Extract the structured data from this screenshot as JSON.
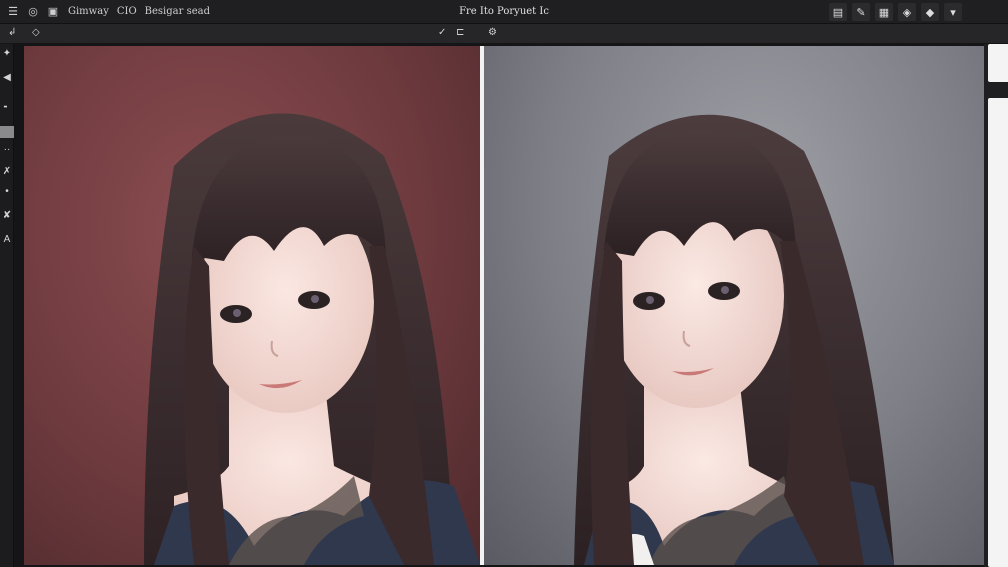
{
  "topbar": {
    "menus": [
      "Gimway",
      "CIO",
      "Besigar sead"
    ],
    "title": "Fre Ito Poryuet Ic"
  },
  "portrait_icon": "portrait-figure-icon",
  "icons": {
    "menu": "hamburger-icon",
    "app": "app-logo-icon",
    "square": "square-icon",
    "tool_move": "move-icon",
    "tool_lasso": "lasso-icon",
    "tool_brush": "brush-icon",
    "tool_rect": "rectangle-icon",
    "tool_heal": "heal-icon",
    "tool_text": "text-icon"
  },
  "colors": {
    "left_background": "#6e3a3e",
    "right_background": "#7d7e86",
    "hair": "#3a2a2c",
    "skin": "#f0d8d2",
    "top": "#30384e",
    "lace": "#5a504c"
  }
}
